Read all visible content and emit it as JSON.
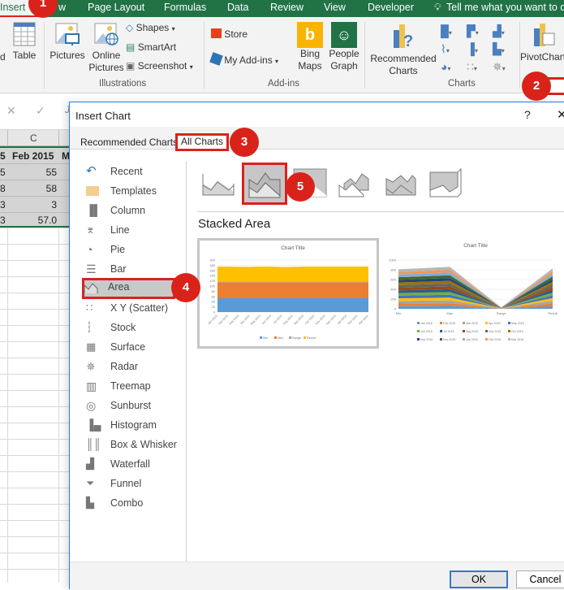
{
  "ribbon_tabs": [
    {
      "label": "Insert",
      "active": true
    },
    {
      "label": "w",
      "active": false
    },
    {
      "label": "Page Layout",
      "active": false
    },
    {
      "label": "Formulas",
      "active": false
    },
    {
      "label": "Data",
      "active": false
    },
    {
      "label": "Review",
      "active": false
    },
    {
      "label": "View",
      "active": false
    },
    {
      "label": "Developer",
      "active": false
    }
  ],
  "tell_me": "Tell me what you want to do",
  "ribbon": {
    "tables": {
      "partial_label": "d",
      "table": "Table"
    },
    "illustrations": {
      "pictures": "Pictures",
      "online_pictures_1": "Online",
      "online_pictures_2": "Pictures",
      "shapes": "Shapes",
      "smartart": "SmartArt",
      "screenshot": "Screenshot",
      "group_label": "Illustrations"
    },
    "addins": {
      "store": "Store",
      "my_addins": "My Add-ins",
      "bing_1": "Bing",
      "bing_2": "Maps",
      "people_1": "People",
      "people_2": "Graph",
      "group_label": "Add-ins"
    },
    "charts": {
      "recommended_1": "Recommended",
      "recommended_2": "Charts",
      "pivotchart": "PivotChart",
      "group_label": "Charts"
    }
  },
  "formula_bar": {
    "cancel": "✕",
    "enter": "✓",
    "fx_partial": "J"
  },
  "sheet": {
    "column_header": "C",
    "header_row": {
      "b": "5",
      "c": "Feb 2015",
      "d": "M"
    },
    "rows": [
      {
        "b": "5",
        "c": "55"
      },
      {
        "b": "8",
        "c": "58"
      },
      {
        "b": "3",
        "c": "3"
      },
      {
        "b": "3",
        "c": "57.0"
      }
    ]
  },
  "callouts": [
    "1",
    "2",
    "3",
    "4",
    "5"
  ],
  "dialog": {
    "title": "Insert Chart",
    "help": "?",
    "close": "✕",
    "tabs": [
      {
        "label": "Recommended Charts",
        "selected": false
      },
      {
        "label": "All Charts",
        "selected": true
      }
    ],
    "chart_types": [
      {
        "label": "Recent",
        "icon": "recent-icon"
      },
      {
        "label": "Templates",
        "icon": "folder-icon"
      },
      {
        "label": "Column",
        "icon": "column-chart-icon"
      },
      {
        "label": "Line",
        "icon": "line-chart-icon"
      },
      {
        "label": "Pie",
        "icon": "pie-chart-icon"
      },
      {
        "label": "Bar",
        "icon": "bar-chart-icon"
      },
      {
        "label": "Area",
        "icon": "area-chart-icon",
        "selected": true
      },
      {
        "label": "X Y (Scatter)",
        "icon": "scatter-chart-icon"
      },
      {
        "label": "Stock",
        "icon": "stock-chart-icon"
      },
      {
        "label": "Surface",
        "icon": "surface-chart-icon"
      },
      {
        "label": "Radar",
        "icon": "radar-chart-icon"
      },
      {
        "label": "Treemap",
        "icon": "treemap-chart-icon"
      },
      {
        "label": "Sunburst",
        "icon": "sunburst-chart-icon"
      },
      {
        "label": "Histogram",
        "icon": "histogram-chart-icon"
      },
      {
        "label": "Box & Whisker",
        "icon": "box-whisker-chart-icon"
      },
      {
        "label": "Waterfall",
        "icon": "waterfall-chart-icon"
      },
      {
        "label": "Funnel",
        "icon": "funnel-chart-icon"
      },
      {
        "label": "Combo",
        "icon": "combo-chart-icon"
      }
    ],
    "subtypes": [
      "Area",
      "Stacked Area",
      "100% Stacked Area",
      "3-D Area",
      "3-D Stacked Area",
      "3-D 100% Stacked Area"
    ],
    "selected_subtype_index": 1,
    "subtype_name": "Stacked Area",
    "ok": "OK",
    "cancel": "Cancel"
  },
  "chart_data": [
    {
      "type": "area",
      "title": "Chart Title",
      "stacked": true,
      "categories": [
        "Jan 2015",
        "Feb 2015",
        "Mar 2015",
        "Apr 2015",
        "May 2015",
        "Jun 2015",
        "Jul 2015",
        "Aug 2015",
        "Sep 2015",
        "Oct 2015",
        "Nov 2015",
        "Dec 2015",
        "Jan 2016",
        "Feb 2016",
        "Mar 2016"
      ],
      "ylim": [
        0,
        200
      ],
      "yticks": [
        0,
        20,
        40,
        60,
        80,
        100,
        120,
        140,
        160,
        180,
        200
      ],
      "series": [
        {
          "name": "Min",
          "color": "#5b9bd5",
          "values": [
            53,
            53,
            53,
            53,
            53,
            53,
            53,
            53,
            53,
            53,
            53,
            53,
            53,
            53,
            53
          ]
        },
        {
          "name": "Max",
          "color": "#ed7d31",
          "values": [
            62,
            62,
            62,
            62,
            62,
            62,
            62,
            62,
            62,
            62,
            62,
            62,
            62,
            62,
            62
          ]
        },
        {
          "name": "Range",
          "color": "#a5a5a5",
          "values": [
            3,
            3,
            3,
            3,
            3,
            3,
            3,
            3,
            3,
            3,
            3,
            3,
            3,
            3,
            3
          ]
        },
        {
          "name": "Result",
          "color": "#ffc000",
          "values": [
            57,
            57,
            56,
            56,
            57,
            57,
            55,
            56,
            57,
            57,
            57,
            57,
            57,
            57,
            57
          ]
        }
      ],
      "legend": "bottom",
      "grid": true
    },
    {
      "type": "area",
      "title": "Chart Title",
      "stacked": true,
      "categories": [
        "Min",
        "Max",
        "Range",
        "Result"
      ],
      "ylim": [
        0,
        1000
      ],
      "yticks": [
        0,
        200,
        400,
        600,
        800,
        1000
      ],
      "series_names": [
        "Jan 2015",
        "Feb 2015",
        "Mar 2015",
        "Apr 2015",
        "May 2015",
        "Jun 2015",
        "Jul 2015",
        "Aug 2015",
        "Sep 2015",
        "Oct 2015",
        "Nov 2015",
        "Dec 2015",
        "Jan 2016",
        "Feb 2016",
        "Mar 2016"
      ],
      "series_colors": [
        "#5b9bd5",
        "#ed7d31",
        "#a5a5a5",
        "#ffc000",
        "#4472c4",
        "#70ad47",
        "#255e91",
        "#9e480e",
        "#636363",
        "#997300",
        "#264478",
        "#43682b",
        "#7cafdd",
        "#f1975a",
        "#b7b7b7"
      ],
      "stack_totals": [
        810,
        860,
        30,
        830
      ],
      "legend": "bottom",
      "grid": true
    }
  ]
}
